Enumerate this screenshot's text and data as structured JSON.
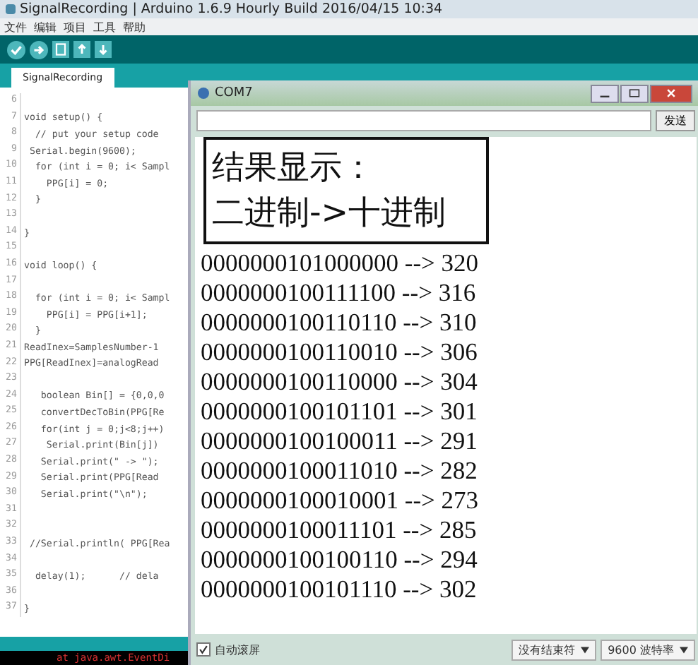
{
  "ide": {
    "title": "SignalRecording | Arduino 1.6.9 Hourly Build 2016/04/15 10:34",
    "menu": [
      "文件",
      "编辑",
      "项目",
      "工具",
      "帮助"
    ],
    "tabs": [
      {
        "label": "SignalRecording",
        "selected": true
      }
    ],
    "code_lines": [
      {
        "number": "6"
      },
      {
        "number": "7",
        "text": "void setup() {"
      },
      {
        "number": "8",
        "text": "  // put your setup code "
      },
      {
        "number": "9",
        "text": " Serial.begin(9600);"
      },
      {
        "number": "10",
        "text": "  for (int i = 0; i< Sampl"
      },
      {
        "number": "11",
        "text": "    PPG[i] = 0;"
      },
      {
        "number": "12",
        "text": "  }"
      },
      {
        "number": "13"
      },
      {
        "number": "14",
        "text": "}"
      },
      {
        "number": "15"
      },
      {
        "number": "16",
        "text": "void loop() {"
      },
      {
        "number": "17"
      },
      {
        "number": "18",
        "text": "  for (int i = 0; i< Sampl"
      },
      {
        "number": "19",
        "text": "    PPG[i] = PPG[i+1];"
      },
      {
        "number": "20",
        "text": "  }"
      },
      {
        "number": "21",
        "text": "ReadInex=SamplesNumber-1"
      },
      {
        "number": "22",
        "text": "PPG[ReadInex]=analogRead"
      },
      {
        "number": "23"
      },
      {
        "number": "24",
        "text": "   boolean Bin[] = {0,0,0"
      },
      {
        "number": "25",
        "text": "   convertDecToBin(PPG[Re"
      },
      {
        "number": "26",
        "text": "   for(int j = 0;j<8;j++)"
      },
      {
        "number": "27",
        "text": "    Serial.print(Bin[j])"
      },
      {
        "number": "28",
        "text": "   Serial.print(\" -> \");"
      },
      {
        "number": "29",
        "text": "   Serial.print(PPG[Read"
      },
      {
        "number": "30",
        "text": "   Serial.print(\"\\n\");"
      },
      {
        "number": "31"
      },
      {
        "number": "32"
      },
      {
        "number": "33",
        "text": " //Serial.println( PPG[Rea"
      },
      {
        "number": "34"
      },
      {
        "number": "35",
        "text": "  delay(1);      // dela"
      },
      {
        "number": "36"
      },
      {
        "number": "37",
        "text": "}"
      }
    ],
    "console_line": "at java.awt.EventDi"
  },
  "serial_monitor": {
    "title": "COM7",
    "send_button": "发送",
    "heading_lines": [
      "结果显示：",
      "二进制->十进制"
    ],
    "output_lines": [
      "0000000101000000 --> 320",
      "0000000100111100 --> 316",
      "0000000100110110 --> 310",
      "0000000100110010 --> 306",
      "0000000100110000 --> 304",
      "0000000100101101 --> 301",
      "0000000100100011 --> 291",
      "0000000100011010 --> 282",
      "0000000100010001 --> 273",
      "0000000100011101 --> 285",
      "0000000100100110 --> 294",
      "0000000100101110 --> 302"
    ],
    "autoscroll": {
      "label": "自动滚屏",
      "checked": true
    },
    "line_ending": "没有结束符",
    "baud_rate": "9600 波特率"
  }
}
